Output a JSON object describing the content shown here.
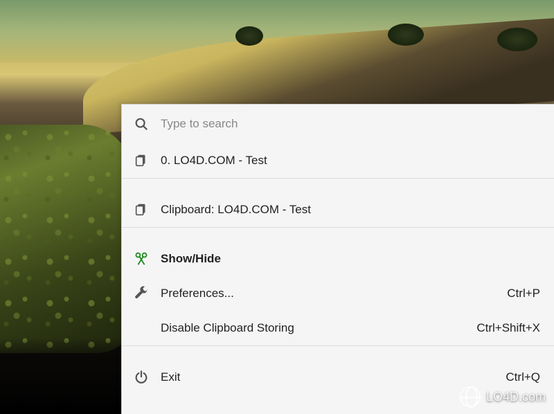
{
  "search": {
    "placeholder": "Type to search"
  },
  "history": [
    {
      "label": "0. LO4D.COM - Test"
    }
  ],
  "clipboard_current": {
    "label": "Clipboard: LO4D.COM - Test"
  },
  "menu": {
    "show_hide": {
      "label": "Show/Hide"
    },
    "preferences": {
      "label": "Preferences...",
      "shortcut": "Ctrl+P"
    },
    "disable_storing": {
      "label": "Disable Clipboard Storing",
      "shortcut": "Ctrl+Shift+X"
    },
    "exit": {
      "label": "Exit",
      "shortcut": "Ctrl+Q"
    }
  },
  "watermark": {
    "text": "LO4D.com"
  },
  "icons": {
    "search": "search-icon",
    "clipboard": "clipboard-icon",
    "app": "scissors-icon",
    "wrench": "wrench-icon",
    "power": "power-icon"
  }
}
